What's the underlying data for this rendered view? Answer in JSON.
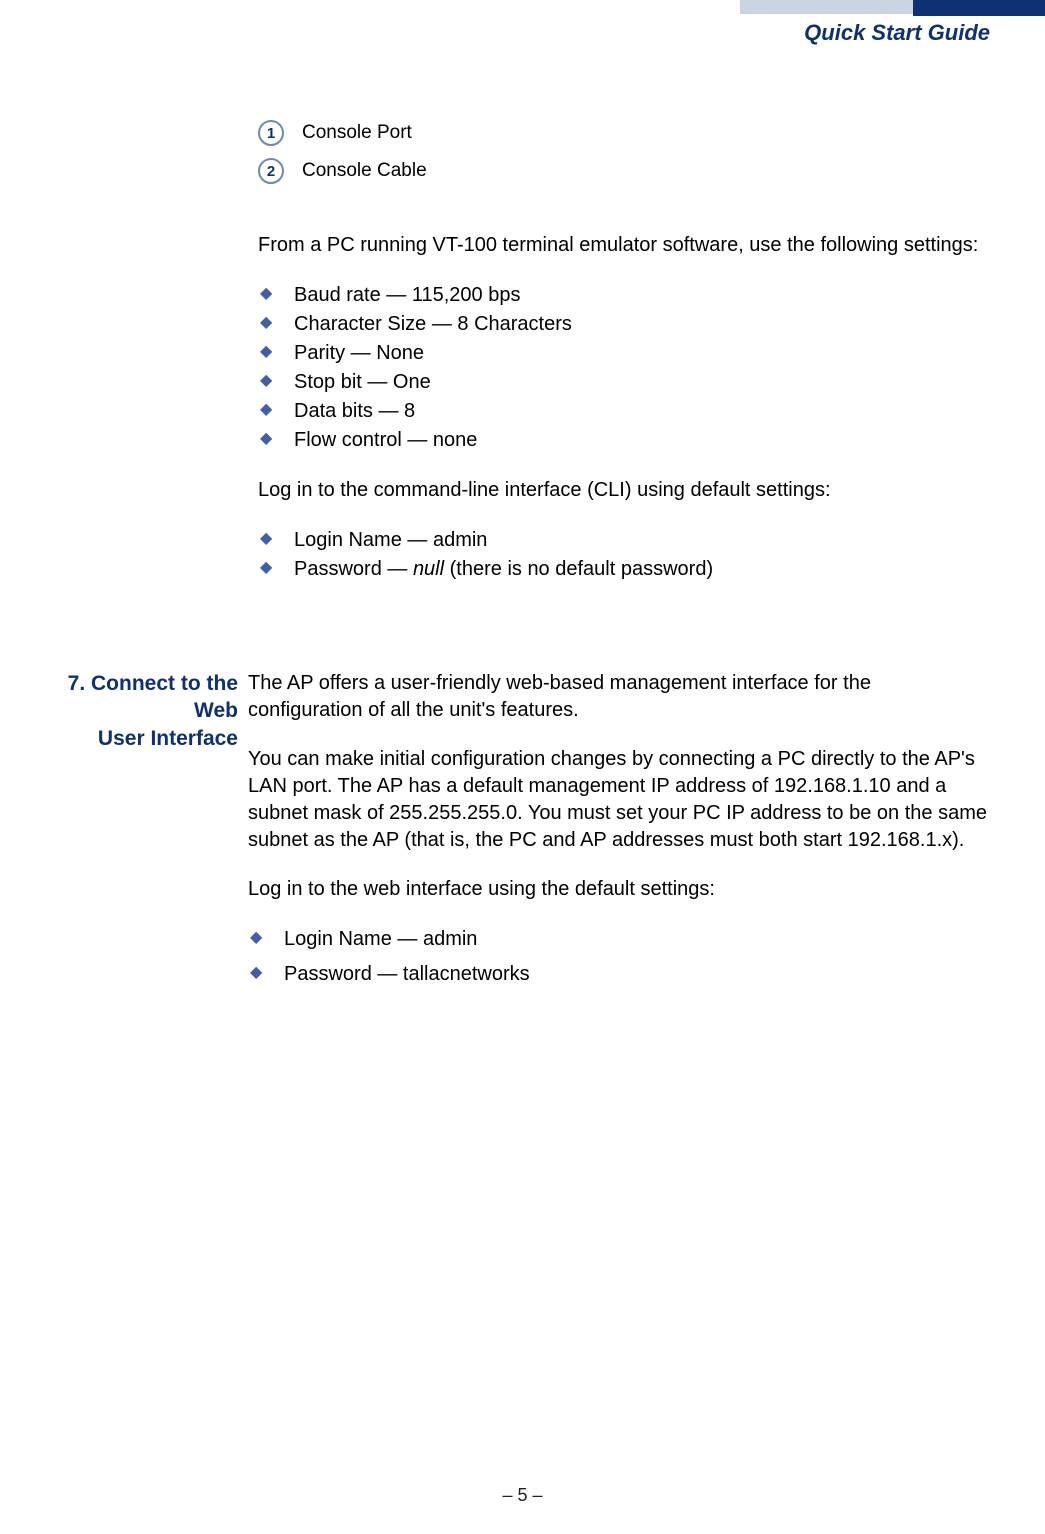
{
  "header": {
    "title": "Quick Start Guide"
  },
  "legend": {
    "items": [
      {
        "num": "1",
        "label": "Console Port"
      },
      {
        "num": "2",
        "label": "Console Cable"
      }
    ]
  },
  "intro1": "From a PC running VT-100 terminal emulator software, use the following settings:",
  "settings": [
    "Baud rate — 115,200 bps",
    "Character Size — 8 Characters",
    "Parity — None",
    "Stop bit — One",
    "Data bits — 8",
    "Flow control — none"
  ],
  "intro2": "Log in to the command-line interface (CLI) using default settings:",
  "cli_login": {
    "name_label": "Login Name — admin",
    "password_prefix": "Password — ",
    "password_null": "null",
    "password_suffix": " (there is no default password)"
  },
  "section7": {
    "title_l1": "7. Connect to the Web",
    "title_l2": "User Interface",
    "p1": "The AP offers a user-friendly web-based management interface for the configuration of all the unit's features.",
    "p2": "You can make initial configuration changes by connecting a PC directly to the AP's LAN port. The AP has a default management IP address of 192.168.1.10 and a subnet mask of 255.255.255.0. You must set your PC IP address to be on the same subnet as the AP (that is, the PC and AP addresses must both start 192.168.1.x).",
    "p3": "Log in to the web interface using the default settings:",
    "web_login": [
      "Login Name — admin",
      "Password — tallacnetworks"
    ]
  },
  "footer": "–  5  –"
}
